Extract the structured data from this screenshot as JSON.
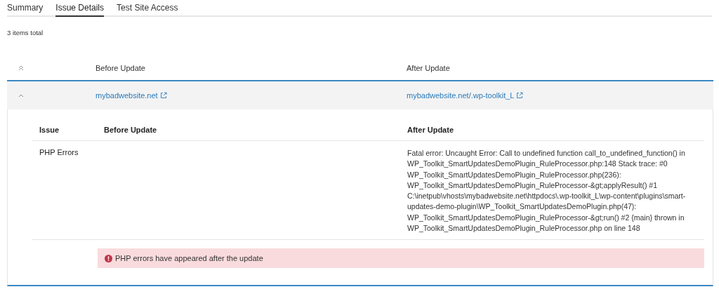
{
  "tabs": [
    {
      "label": "Summary",
      "selected": false
    },
    {
      "label": "Issue Details",
      "selected": true
    },
    {
      "label": "Test Site Access",
      "selected": false
    }
  ],
  "items_total": "3 items total",
  "table": {
    "columns": [
      "Before Update",
      "After Update"
    ],
    "rows": [
      {
        "expanded": true,
        "before": "mybadwebsite.net",
        "after": "mybadwebsite.net/.wp-toolkit_L",
        "details": {
          "columns": [
            "Issue",
            "Before Update",
            "After Update"
          ],
          "rows": [
            {
              "issue": "PHP Errors",
              "before": "",
              "after": "Fatal error: Uncaught Error: Call to undefined function call_to_undefined_function() in WP_Toolkit_SmartUpdatesDemoPlugin_RuleProcessor.php:148 Stack trace: #0 WP_Toolkit_SmartUpdatesDemoPlugin_RuleProcessor.php(236): WP_Toolkit_SmartUpdatesDemoPlugin_RuleProcessor-&gt;applyResult() #1 C:\\inetpub\\vhosts\\mybadwebsite.net\\httpdocs\\.wp-toolkit_L\\wp-content\\plugins\\smart-updates-demo-plugin\\WP_Toolkit_SmartUpdatesDemoPlugin.php(47): WP_Toolkit_SmartUpdatesDemoPlugin_RuleProcessor-&gt;run() #2 {main} thrown in WP_Toolkit_SmartUpdatesDemoPlugin_RuleProcessor.php on line 148"
            }
          ],
          "alert": "PHP errors have appeared after the update"
        }
      }
    ]
  }
}
